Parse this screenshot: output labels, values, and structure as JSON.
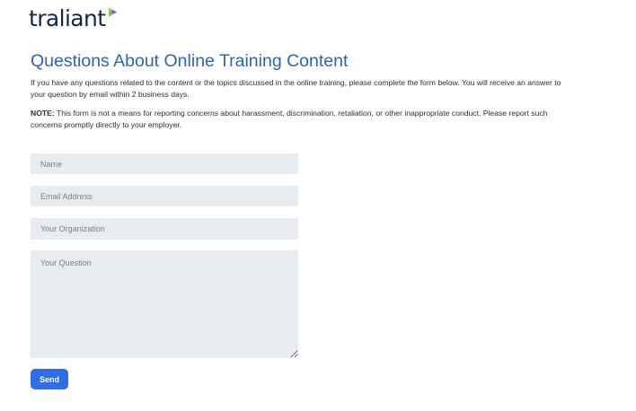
{
  "brand": {
    "logo_text": "traliant",
    "logo_mark_colors": [
      "#1fb5e8",
      "#7ac943",
      "#f4c21b",
      "#8e4fd1"
    ]
  },
  "header": {
    "title": "Questions About Online Training Content"
  },
  "content": {
    "intro": "If you have any questions related to the content or the topics discussed in the online training, please complete the form below. You will receive an answer to your question by email within 2 business days.",
    "note_label": "NOTE:",
    "note_text": " This form is not a means for reporting concerns about harassment, discrimination, retaliation, or other inappropriate conduct. Please report such concerns promptly directly to your employer."
  },
  "form": {
    "name": {
      "placeholder": "Name",
      "value": ""
    },
    "email": {
      "placeholder": "Email Address",
      "value": ""
    },
    "organization": {
      "placeholder": "Your Organization",
      "value": ""
    },
    "question": {
      "placeholder": "Your Question",
      "value": ""
    },
    "send_label": "Send"
  },
  "colors": {
    "title": "#2e63b8",
    "button": "#2f6ee8",
    "field_bg": "#e8ebef"
  }
}
